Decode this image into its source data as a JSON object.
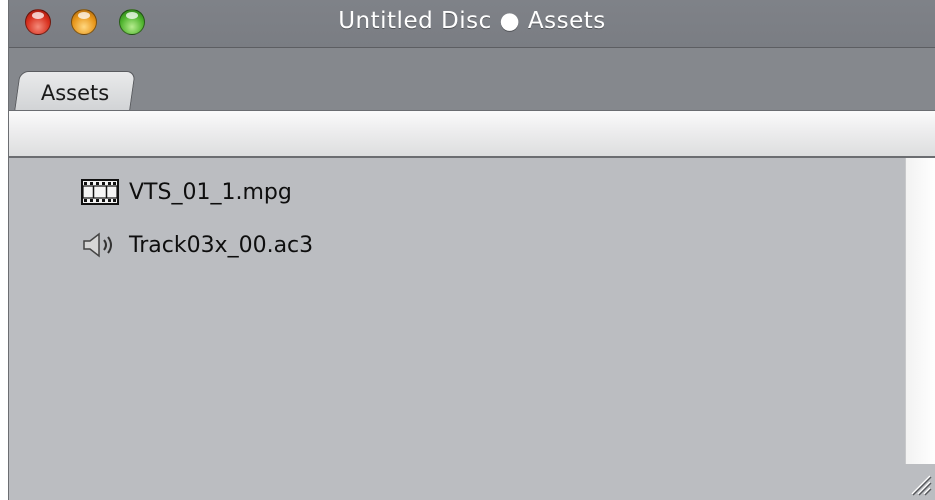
{
  "window": {
    "title": "Untitled Disc ● Assets"
  },
  "tabs": [
    {
      "label": "Assets",
      "selected": true
    }
  ],
  "assets": [
    {
      "name": "VTS_01_1.mpg",
      "icon": "film-icon"
    },
    {
      "name": "Track03x_00.ac3",
      "icon": "speaker-icon"
    }
  ],
  "colors": {
    "titlebar": "#7f8288",
    "tabbar": "#85888d",
    "content_bg": "#bbbdc1",
    "close": "#d8301e",
    "minimize": "#e8961a",
    "zoom": "#4fb42e"
  }
}
